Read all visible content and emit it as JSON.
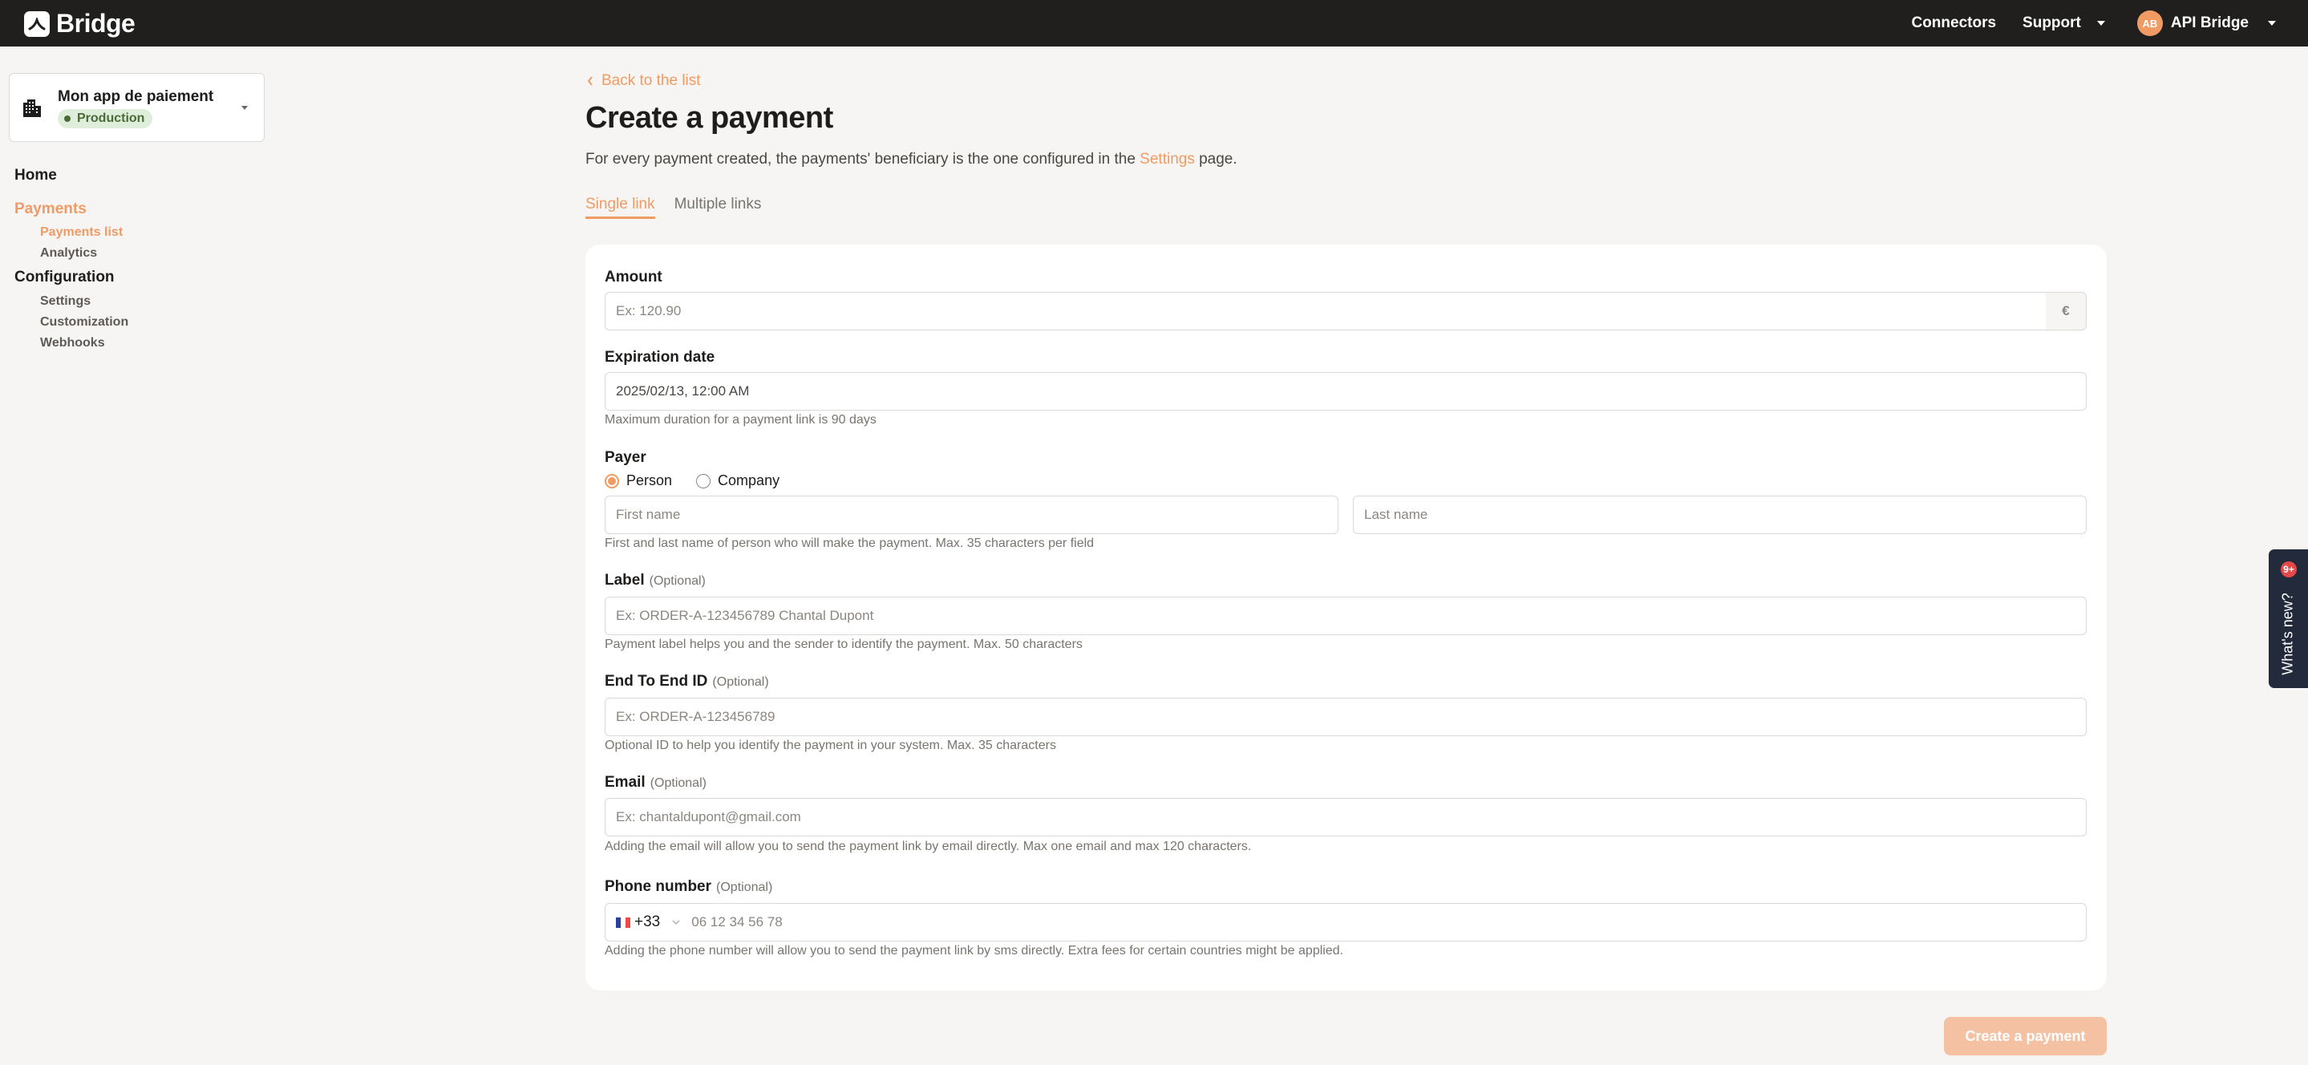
{
  "header": {
    "brand": "Bridge",
    "nav": {
      "connectors": "Connectors",
      "support": "Support"
    },
    "user": {
      "initials": "AB",
      "name": "API Bridge"
    }
  },
  "sidebar": {
    "app_switcher": {
      "app_name": "Mon app de paiement",
      "environment": "Production"
    },
    "nav": {
      "home": "Home",
      "payments": "Payments",
      "payments_list": "Payments list",
      "analytics": "Analytics",
      "configuration": "Configuration",
      "settings": "Settings",
      "customization": "Customization",
      "webhooks": "Webhooks"
    }
  },
  "main": {
    "back_link": "Back to the list",
    "title": "Create a payment",
    "description": {
      "before": "For every payment created, the payments' beneficiary is the one configured in the ",
      "link": "Settings",
      "after": " page."
    },
    "tabs": [
      {
        "label": "Single link",
        "active": true
      },
      {
        "label": "Multiple links",
        "active": false
      }
    ],
    "form": {
      "amount": {
        "label": "Amount",
        "placeholder": "Ex: 120.90",
        "value": "",
        "currency": "€"
      },
      "expiration": {
        "label": "Expiration date",
        "value": "2025/02/13, 12:00 AM",
        "hint": "Maximum duration for a payment link is 90 days"
      },
      "payer": {
        "label": "Payer",
        "options": [
          {
            "label": "Person",
            "checked": true
          },
          {
            "label": "Company",
            "checked": false
          }
        ],
        "first_name_placeholder": "First name",
        "last_name_placeholder": "Last name",
        "hint": "First and last name of person who will make the payment. Max. 35 characters per field"
      },
      "label_field": {
        "label": "Label",
        "optional": "(Optional)",
        "placeholder": "Ex: ORDER-A-123456789 Chantal Dupont",
        "hint": "Payment label helps you and the sender to identify the payment. Max. 50 characters"
      },
      "end_to_end": {
        "label": "End To End ID",
        "optional": "(Optional)",
        "placeholder": "Ex: ORDER-A-123456789",
        "hint": "Optional ID to help you identify the payment in your system. Max. 35 characters"
      },
      "email": {
        "label": "Email",
        "optional": "(Optional)",
        "placeholder": "Ex: chantaldupont@gmail.com",
        "hint": "Adding the email will allow you to send the payment link by email directly. Max one email and max 120 characters."
      },
      "phone": {
        "label": "Phone number",
        "optional": "(Optional)",
        "country_code": "+33",
        "placeholder": "06 12 34 56 78",
        "hint": "Adding the phone number will allow you to send the payment link by sms directly. Extra fees for certain countries might be applied."
      }
    },
    "submit_label": "Create a payment"
  },
  "whats_new": {
    "label": "What's new?",
    "badge": "9+"
  },
  "colors": {
    "accent": "#f09b64",
    "topbar": "#201f1d",
    "background": "#f6f5f3",
    "env_badge_bg": "#dfeeda",
    "env_badge_text": "#4a6b36",
    "whats_new_bg": "#232a3b",
    "notification_badge": "#e54848"
  }
}
